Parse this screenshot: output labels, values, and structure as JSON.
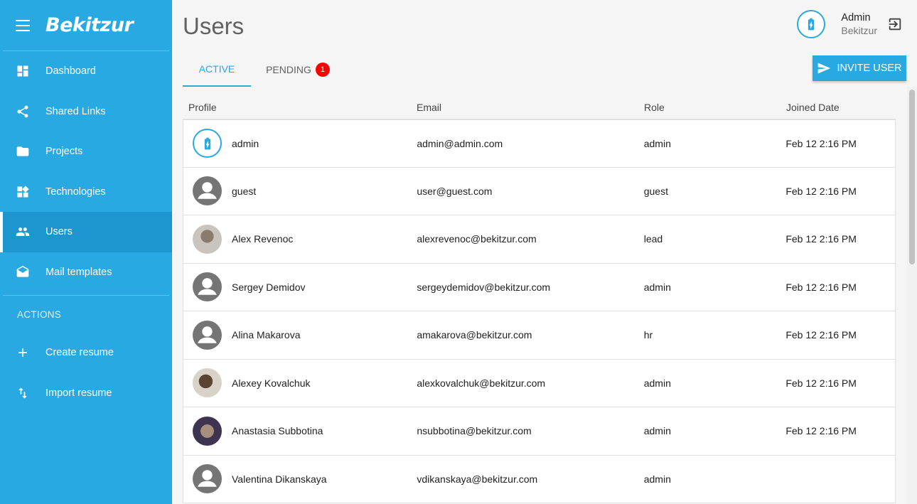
{
  "app": {
    "logo": "Bekitzur"
  },
  "sidebar": {
    "items": [
      {
        "label": "Dashboard",
        "icon": "dashboard-icon"
      },
      {
        "label": "Shared Links",
        "icon": "share-icon"
      },
      {
        "label": "Projects",
        "icon": "folder-icon"
      },
      {
        "label": "Technologies",
        "icon": "widgets-icon"
      },
      {
        "label": "Users",
        "icon": "people-icon",
        "active": true
      },
      {
        "label": "Mail templates",
        "icon": "mail-icon"
      }
    ],
    "section_label": "ACTIONS",
    "actions": [
      {
        "label": "Create resume",
        "icon": "plus-icon"
      },
      {
        "label": "Import resume",
        "icon": "import-icon"
      }
    ]
  },
  "header": {
    "title": "Users",
    "user_name": "Admin",
    "user_org": "Bekitzur"
  },
  "tabs": {
    "active": "ACTIVE",
    "pending": "PENDING",
    "pending_count": "1"
  },
  "invite_button": "INVITE USER",
  "table": {
    "columns": [
      "Profile",
      "Email",
      "Role",
      "Joined Date"
    ],
    "rows": [
      {
        "name": "admin",
        "email": "admin@admin.com",
        "role": "admin",
        "joined": "Feb 12 2:16 PM",
        "avatar": "app-icon"
      },
      {
        "name": "guest",
        "email": "user@guest.com",
        "role": "guest",
        "joined": "Feb 12 2:16 PM",
        "avatar": "default"
      },
      {
        "name": "Alex Revenoc",
        "email": "alexrevenoc@bekitzur.com",
        "role": "lead",
        "joined": "Feb 12 2:16 PM",
        "avatar": "photo"
      },
      {
        "name": "Sergey Demidov",
        "email": "sergeydemidov@bekitzur.com",
        "role": "admin",
        "joined": "Feb 12 2:16 PM",
        "avatar": "default"
      },
      {
        "name": "Alina Makarova",
        "email": "amakarova@bekitzur.com",
        "role": "hr",
        "joined": "Feb 12 2:16 PM",
        "avatar": "default"
      },
      {
        "name": "Alexey Kovalchuk",
        "email": "alexkovalchuk@bekitzur.com",
        "role": "admin",
        "joined": "Feb 12 2:16 PM",
        "avatar": "photo"
      },
      {
        "name": "Anastasia Subbotina",
        "email": "nsubbotina@bekitzur.com",
        "role": "admin",
        "joined": "Feb 12 2:16 PM",
        "avatar": "photo"
      },
      {
        "name": "Valentina Dikanskaya",
        "email": "vdikanskaya@bekitzur.com",
        "role": "admin",
        "joined": "",
        "avatar": "default"
      }
    ]
  },
  "colors": {
    "primary": "#29a9e1",
    "sidebar_active": "#1d96cf",
    "badge": "#ff0000",
    "title": "#616161"
  }
}
